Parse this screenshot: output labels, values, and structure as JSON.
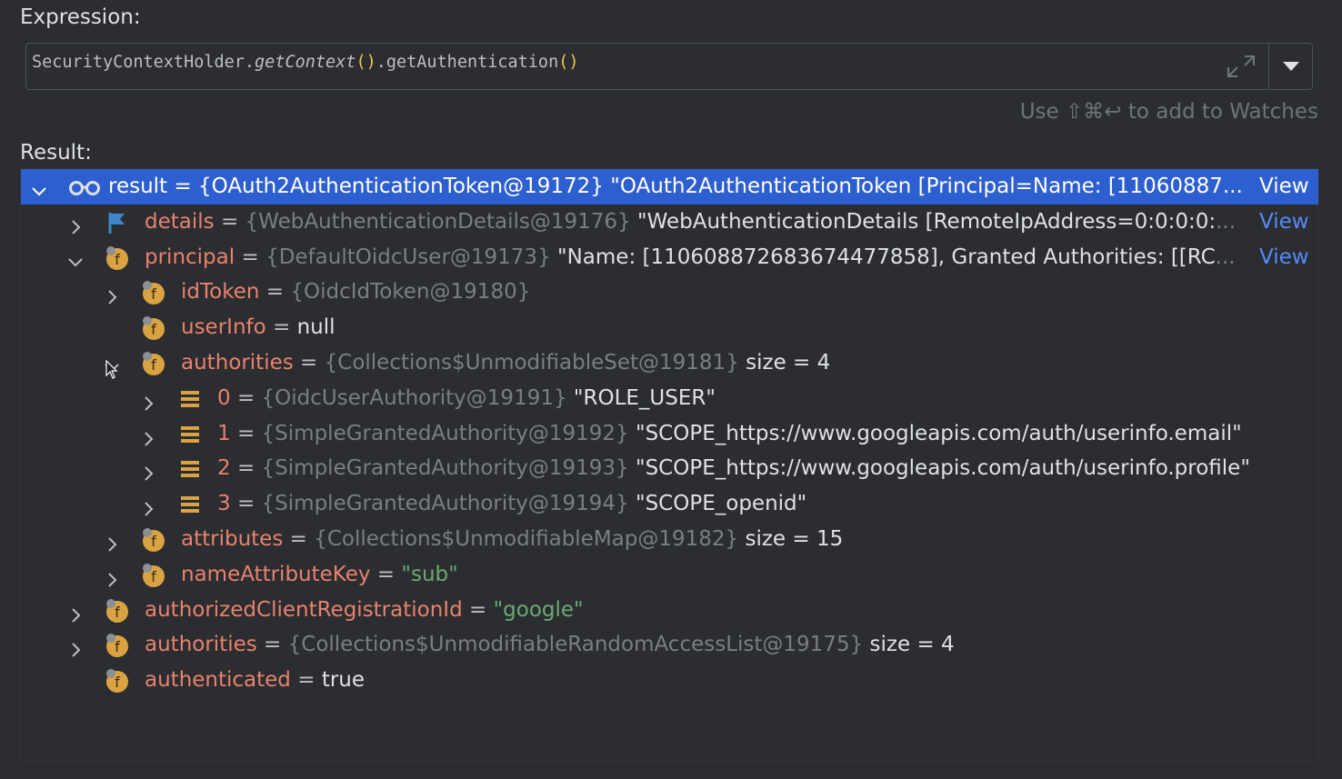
{
  "expression_label": "Expression:",
  "expression": {
    "part1": "SecurityContextHolder.",
    "part2": "getContext",
    "part3": "()",
    "part4": ".getAuthentication",
    "part5": "()"
  },
  "watches_hint": "Use ⇧⌘↩ to add to Watches",
  "result_label": "Result:",
  "view_label": "View",
  "rows": [
    {
      "name": "result",
      "eq": " = ",
      "type": "{OAuth2AuthenticationToken@19172}",
      "val": " \"OAuth2AuthenticationToken [Principal=Name: [11060887",
      "tail": "...",
      "icon": "watch-glasses-icon",
      "expanded": true
    },
    {
      "name": "details",
      "eq": " = ",
      "type": "{WebAuthenticationDetails@19176}",
      "val": " \"WebAuthenticationDetails [RemoteIpAddress=0:0:0:0:",
      "tail": "...",
      "icon": "flag-icon",
      "expanded": false
    },
    {
      "name": "principal",
      "eq": " = ",
      "type": "{DefaultOidcUser@19173}",
      "val": " \"Name: [110608872683674477858], Granted Authorities: [[RC",
      "tail": "...",
      "icon": "field-icon",
      "expanded": true
    },
    {
      "name": "idToken",
      "eq": " = ",
      "type": "{OidcIdToken@19180}",
      "val": "",
      "icon": "field-icon",
      "expanded": false
    },
    {
      "name": "userInfo",
      "eq": " = ",
      "type": "",
      "val": "null",
      "icon": "field-icon"
    },
    {
      "name": "authorities",
      "eq": " = ",
      "type": "{Collections$UnmodifiableSet@19181}",
      "val": "  size = 4",
      "icon": "field-icon",
      "expanded": true
    },
    {
      "name": "0",
      "eq": " = ",
      "type": "{OidcUserAuthority@19191}",
      "val": " \"ROLE_USER\"",
      "icon": "array-element-icon",
      "expanded": false
    },
    {
      "name": "1",
      "eq": " = ",
      "type": "{SimpleGrantedAuthority@19192}",
      "val": " \"SCOPE_https://www.googleapis.com/auth/userinfo.email\"",
      "icon": "array-element-icon",
      "expanded": false
    },
    {
      "name": "2",
      "eq": " = ",
      "type": "{SimpleGrantedAuthority@19193}",
      "val": " \"SCOPE_https://www.googleapis.com/auth/userinfo.profile\"",
      "icon": "array-element-icon",
      "expanded": false
    },
    {
      "name": "3",
      "eq": " = ",
      "type": "{SimpleGrantedAuthority@19194}",
      "val": " \"SCOPE_openid\"",
      "icon": "array-element-icon",
      "expanded": false
    },
    {
      "name": "attributes",
      "eq": " = ",
      "type": "{Collections$UnmodifiableMap@19182}",
      "val": "  size = 15",
      "icon": "field-icon",
      "expanded": false
    },
    {
      "name": "nameAttributeKey",
      "eq": " = ",
      "type": "",
      "val": "\"sub\"",
      "icon": "field-icon",
      "expanded": false
    },
    {
      "name": "authorizedClientRegistrationId",
      "eq": " = ",
      "type": "",
      "val": "\"google\"",
      "icon": "field-icon",
      "expanded": false
    },
    {
      "name": "authorities",
      "eq": " = ",
      "type": "{Collections$UnmodifiableRandomAccessList@19175}",
      "val": "  size = 4",
      "icon": "field-icon",
      "expanded": false
    },
    {
      "name": "authenticated",
      "eq": " = ",
      "type": "",
      "val": "true",
      "icon": "field-icon"
    }
  ],
  "colors": {
    "background": "#2b2d30",
    "selection": "#2e5fd0",
    "field_name": "#e8826e",
    "type_grey": "#7a7e85",
    "string_green": "#6aab73",
    "link_blue": "#548af7",
    "field_icon_orange": "#d9a343"
  }
}
